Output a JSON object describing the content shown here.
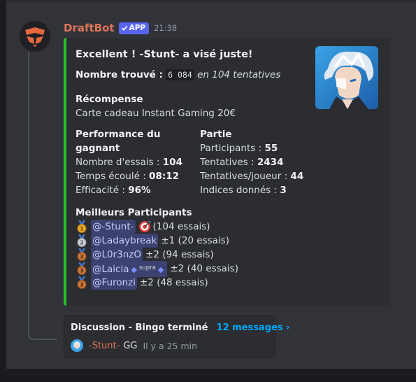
{
  "message": {
    "author": "DraftBot",
    "app_tag": "APP",
    "timestamp": "21:38"
  },
  "embed": {
    "accent_color": "#23c128",
    "title": "Excellent ! -Stunt- a visé juste!",
    "number_label": "Nombre trouvé :",
    "number_value": "6 084",
    "number_suffix": "en 104 tentatives",
    "reward": {
      "name": "Récompense",
      "value": "Carte cadeau Instant Gaming 20€"
    },
    "performance": {
      "name": "Performance du gagnant",
      "lines": [
        {
          "label": "Nombre d'essais :",
          "value": "104"
        },
        {
          "label": "Temps écoulé :",
          "value": "08:12"
        },
        {
          "label": "Efficacité :",
          "value": "96%"
        }
      ]
    },
    "game": {
      "name": "Partie",
      "lines": [
        {
          "label": "Participants :",
          "value": "55"
        },
        {
          "label": "Tentatives :",
          "value": "2434"
        },
        {
          "label": "Tentatives/joueur :",
          "value": "44"
        },
        {
          "label": "Indices donnés :",
          "value": "3"
        }
      ]
    },
    "top": {
      "name": "Meilleurs Participants",
      "rows": [
        {
          "mention": "@-Stunt-",
          "text": "(104 essais)",
          "medal": "gold"
        },
        {
          "mention": "@Ladaybreak",
          "text": "±1 (20 essais)",
          "medal": "silver"
        },
        {
          "mention": "@L0r3nzO",
          "text": "±2 (94 essais)",
          "medal": "bronze"
        },
        {
          "mention": "@Laicia",
          "supra": "supra",
          "text": "±2 (40 essais)",
          "medal": "bronze"
        },
        {
          "mention": "@Furonzi",
          "text": "±2 (48 essais)",
          "medal": "bronze"
        }
      ]
    }
  },
  "thread": {
    "name": "Discussion - Bingo terminé",
    "count": "12 messages ›",
    "last_user": "-Stunt-",
    "last_message": "GG",
    "last_time": "Il y a 25 min"
  },
  "colors": {
    "background": "#313338",
    "embed": "#2b2d31",
    "username": "#e0745a",
    "link": "#00a8fc",
    "mention_bg": "#3c4270"
  }
}
